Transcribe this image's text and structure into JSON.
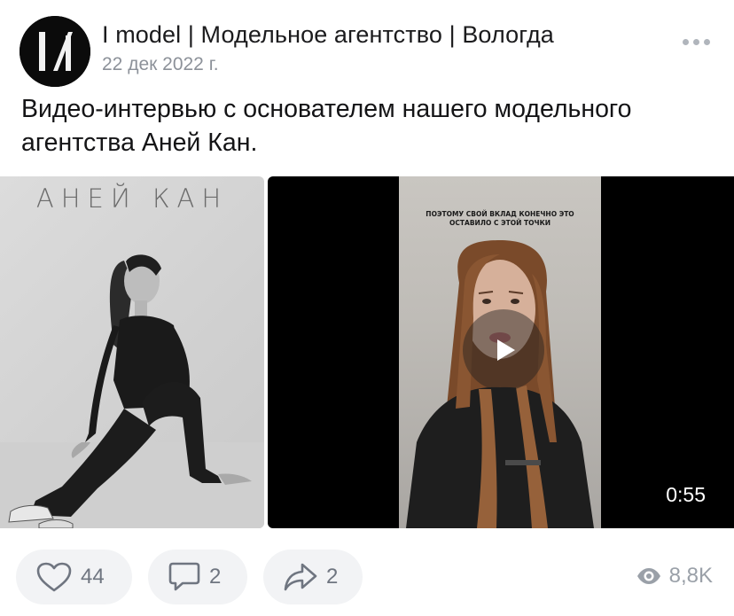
{
  "post": {
    "author": "I model | Модельное агентство | Вологда",
    "date": "22 дек 2022 г.",
    "text": "Видео-интервью с основателем нашего модельного агентства Аней Кан."
  },
  "media": {
    "photo_caption": "АНЕЙ КАН",
    "video_subtitle": "ПОЭТОМУ СВОЙ ВКЛАД КОНЕЧНО ЭТО ОСТАВИЛО С ЭТОЙ ТОЧКИ",
    "video_duration": "0:55"
  },
  "actions": {
    "likes": "44",
    "comments": "2",
    "shares": "2",
    "views": "8,8K"
  },
  "icons": {
    "more": "more-dots-icon",
    "like": "heart-icon",
    "comment": "comment-icon",
    "share": "share-arrow-icon",
    "views": "eye-icon",
    "play": "play-icon"
  },
  "colors": {
    "text": "#141416",
    "muted": "#8c9199",
    "pill_bg": "#f2f3f5",
    "icon": "#6f7580"
  }
}
